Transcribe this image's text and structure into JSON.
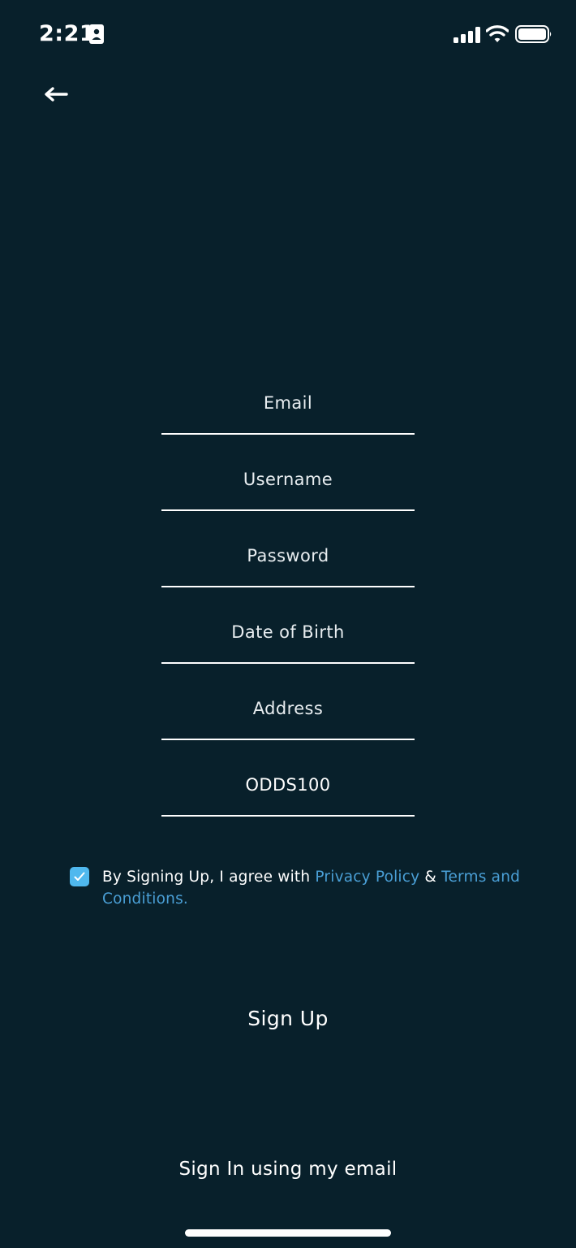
{
  "status_bar": {
    "time": "2:21",
    "icons": [
      "contact-card-icon",
      "cellular-signal-icon",
      "wifi-icon",
      "battery-icon"
    ]
  },
  "navigation": {
    "back_icon": "arrow-left-icon"
  },
  "form": {
    "email": {
      "placeholder": "Email",
      "value": ""
    },
    "username": {
      "placeholder": "Username",
      "value": ""
    },
    "password": {
      "placeholder": "Password",
      "value": ""
    },
    "date_of_birth": {
      "placeholder": "Date of Birth",
      "value": ""
    },
    "address": {
      "placeholder": "Address",
      "value": ""
    },
    "promo_code": {
      "placeholder": "",
      "value": "ODDS100"
    }
  },
  "agreement": {
    "checked": true,
    "text": "By Signing Up, I agree with ",
    "privacy_link": "Privacy Policy",
    "connector": " & ",
    "terms_link": "Terms and Conditions."
  },
  "actions": {
    "sign_up_label": "Sign Up",
    "sign_in_label": "Sign In using my email"
  },
  "colors": {
    "background": "#08202b",
    "accent": "#4fb8ee",
    "link": "#4a9fd6",
    "text": "#ffffff"
  }
}
